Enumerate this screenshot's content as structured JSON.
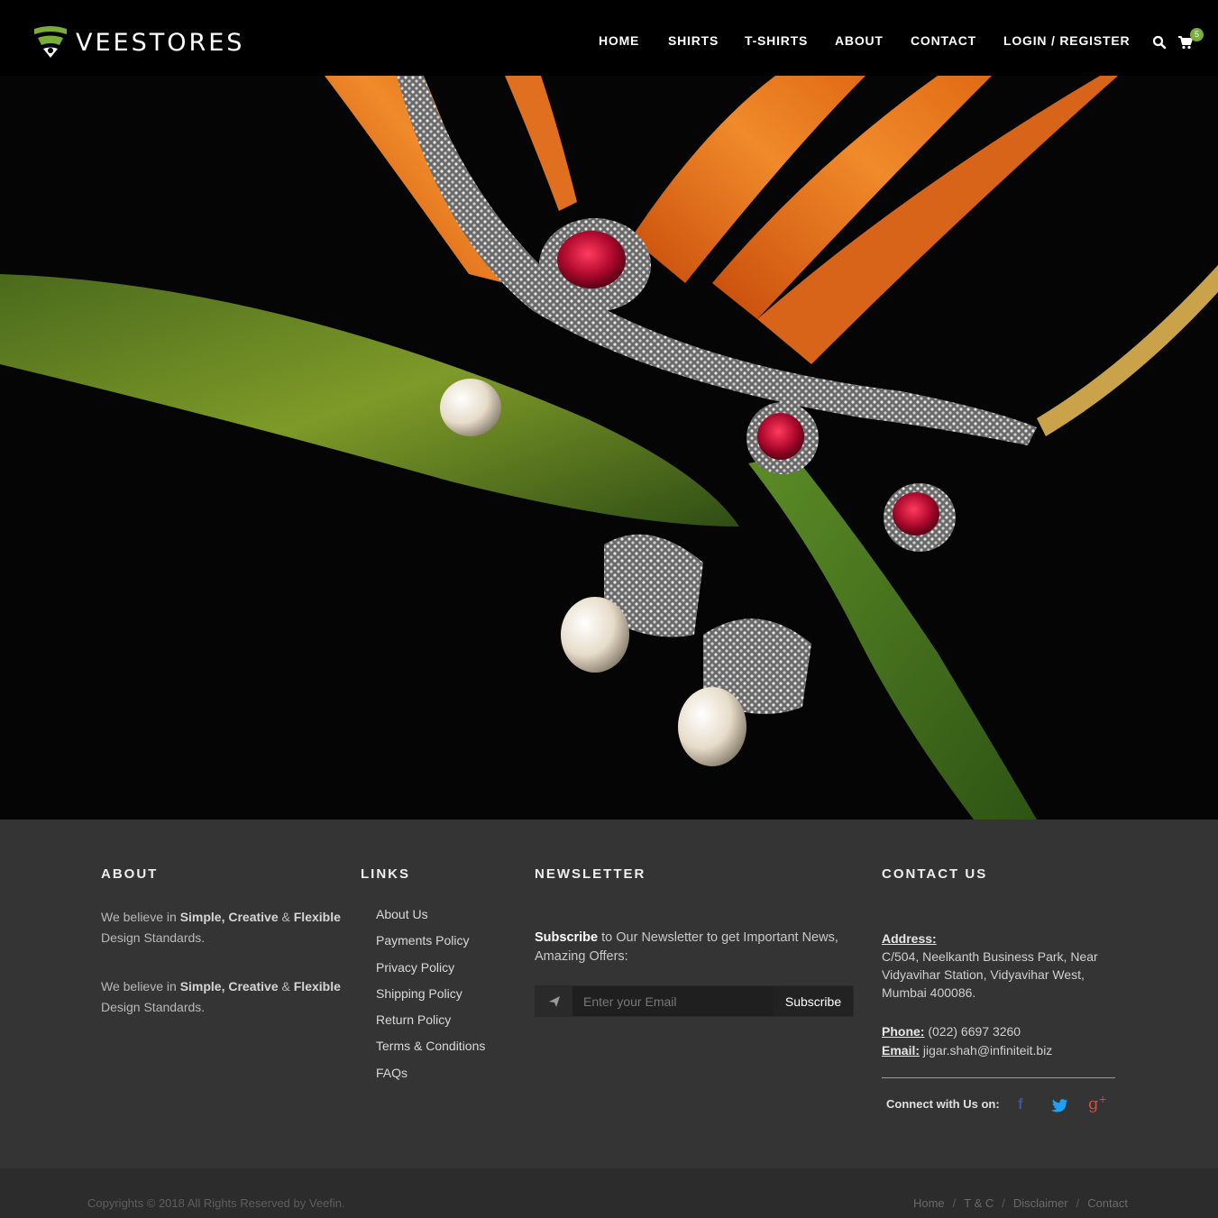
{
  "brand": {
    "name": "VEESTORES",
    "accent": "#7aae3b"
  },
  "nav": {
    "items": [
      "HOME",
      "SHIRTS",
      "T-SHIRTS",
      "ABOUT",
      "CONTACT",
      "LOGIN / REGISTER"
    ],
    "search_icon": "search-icon",
    "cart_icon": "shopping-cart-icon",
    "cart_count": "5"
  },
  "hero": {
    "subject": "jewelry-necklace-and-earrings-on-bird-of-paradise-flower"
  },
  "footer": {
    "about": {
      "title": "ABOUT",
      "p1_pre": "We believe in ",
      "p1_bold": "Simple, Creative",
      "p1_amp": " & ",
      "p1_bold2": "Flexible",
      "p1_post": " Design Standards.",
      "p2_pre": "We believe in ",
      "p2_bold": "Simple, Creative",
      "p2_amp": " & ",
      "p2_bold2": "Flexible",
      "p2_post": " Design Standards."
    },
    "links": {
      "title": "LINKS",
      "items": [
        "About Us",
        "Payments Policy",
        "Privacy Policy",
        "Shipping Policy",
        "Return Policy",
        "Terms & Conditions",
        "FAQs"
      ]
    },
    "newsletter": {
      "title": "NEWSLETTER",
      "bold": "Subscribe",
      "text": " to Our Newsletter to get Important News, Amazing Offers:",
      "placeholder": "Enter your Email",
      "button": "Subscribe",
      "icon": "paper-plane-icon"
    },
    "contact": {
      "title": "CONTACT US",
      "address_label": "Address:",
      "address": "C/504, Neelkanth Business Park, Near Vidyavihar Station, Vidyavihar West, Mumbai 400086.",
      "phone_label": "Phone:",
      "phone": " (022) 6697 3260",
      "email_label": "Email:",
      "email": " jigar.shah@infiniteit.biz",
      "connect_label": "Connect with Us on:",
      "social": [
        {
          "name": "facebook",
          "glyph": "f",
          "color": "#3b5998"
        },
        {
          "name": "twitter",
          "glyph": "twitter-bird",
          "color": "#1da1f2"
        },
        {
          "name": "google-plus",
          "glyph": "g+",
          "color": "#dd4b39"
        }
      ]
    }
  },
  "bottombar": {
    "copyright": "Copyrights © 2018 All Rights Reserved by Veefin.",
    "links": [
      "Home",
      "T & C",
      "Disclaimer",
      "Contact"
    ],
    "separator": "/"
  }
}
